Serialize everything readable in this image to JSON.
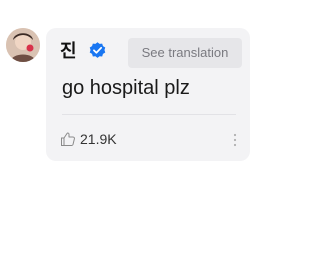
{
  "comment": {
    "author_name": "진",
    "translate_label": "See translation",
    "message": "go hospital plz",
    "like_count": "21.9K"
  },
  "icons": {
    "avatar": "avatar-image",
    "verified": "verified-badge-icon",
    "like": "thumbs-up-icon",
    "more": "more-vertical-icon"
  },
  "colors": {
    "verified": "#1976f2",
    "card_bg": "#f3f3f5",
    "translate_bg": "#e6e6e9"
  }
}
